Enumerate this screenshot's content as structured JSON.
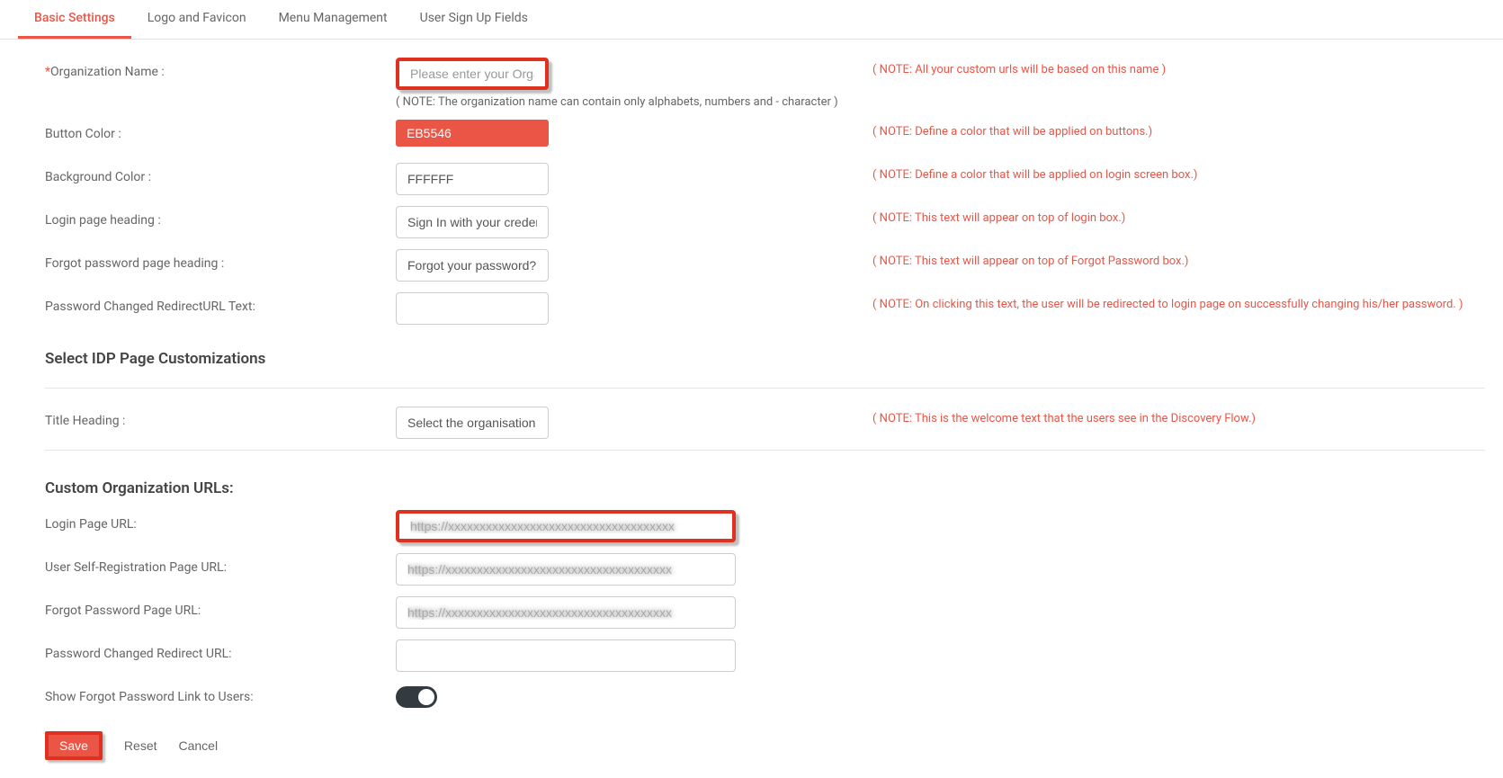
{
  "tabs": [
    "Basic Settings",
    "Logo and Favicon",
    "Menu Management",
    "User Sign Up Fields"
  ],
  "fields": {
    "org_name": {
      "label": "Organization Name :",
      "placeholder": "Please enter your Organi",
      "value": "",
      "subnote": "( NOTE: The organization name can contain only alphabets, numbers and - character )",
      "note": "( NOTE: All your custom urls will be based on this name )"
    },
    "button_color": {
      "label": "Button Color :",
      "value": "EB5546",
      "note": "( NOTE: Define a color that will be applied on buttons.)"
    },
    "bg_color": {
      "label": "Background Color :",
      "value": "FFFFFF",
      "note": "( NOTE: Define a color that will be applied on login screen box.)"
    },
    "login_heading": {
      "label": "Login page heading :",
      "value": "Sign In with your credent",
      "note": "( NOTE: This text will appear on top of login box.)"
    },
    "forgot_heading": {
      "label": "Forgot password page heading :",
      "value": "Forgot your password?",
      "note": "( NOTE: This text will appear on top of Forgot Password box.)"
    },
    "pwd_redirect_text": {
      "label": "Password Changed RedirectURL Text:",
      "value": "",
      "note": "( NOTE: On clicking this text, the user will be redirected to login page on successfully changing his/her password. )"
    }
  },
  "idp": {
    "heading": "Select IDP Page Customizations",
    "title_heading": {
      "label": "Title Heading :",
      "value": "Select the organisation y",
      "note": "( NOTE: This is the welcome text that the users see in the Discovery Flow.)"
    }
  },
  "urls": {
    "heading": "Custom Organization URLs:",
    "login": {
      "label": "Login Page URL:"
    },
    "self_reg": {
      "label": "User Self-Registration Page URL:"
    },
    "forgot": {
      "label": "Forgot Password Page URL:"
    },
    "pwd_redirect": {
      "label": "Password Changed Redirect URL:"
    },
    "show_forgot": {
      "label": "Show Forgot Password Link to Users:"
    }
  },
  "actions": {
    "save": "Save",
    "reset": "Reset",
    "cancel": "Cancel"
  }
}
